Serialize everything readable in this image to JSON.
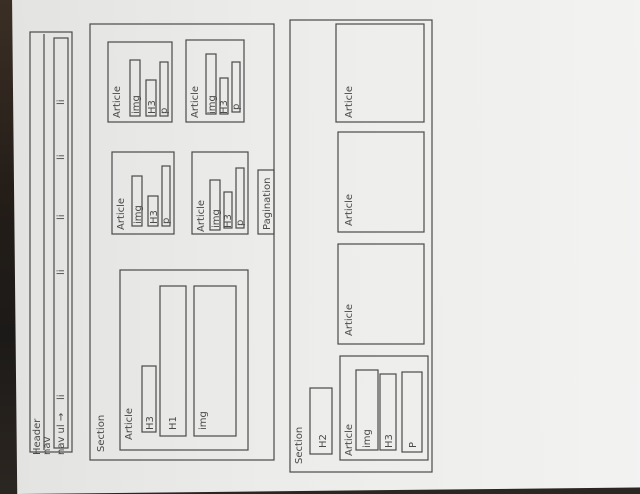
{
  "header": {
    "header_label": "Header",
    "nav_label": "nav",
    "nav_ul_label": "nav ul →",
    "nav_items": [
      "li",
      "li",
      "li",
      "li",
      "li"
    ]
  },
  "hero_section": {
    "section_label": "Section",
    "article_label": "Article",
    "h3_label": "H3",
    "h1_label": "H1",
    "img_label": "img"
  },
  "small_articles": [
    {
      "article_label": "Article",
      "img_label": "img",
      "h3_label": "H3",
      "p_label": "p"
    },
    {
      "article_label": "Article",
      "img_label": "img",
      "h3_label": "H3",
      "p_label": "p"
    },
    {
      "article_label": "Article",
      "img_label": "img",
      "h3_label": "H3",
      "p_label": "p"
    },
    {
      "article_label": "Article",
      "img_label": "img",
      "h3_label": "H3",
      "p_label": "p"
    }
  ],
  "pagination_label": "Pagination",
  "bottom_section": {
    "section_label": "Section",
    "h2_label": "H2",
    "article_label": "Article",
    "img_label": "img",
    "h3_label": "H3",
    "p_label": "P",
    "other_article_labels": [
      "Article",
      "Article",
      "Article"
    ]
  },
  "colors": {
    "pencil": "#4a4a4a",
    "paper": "#ececea",
    "background": "#2a2622"
  }
}
